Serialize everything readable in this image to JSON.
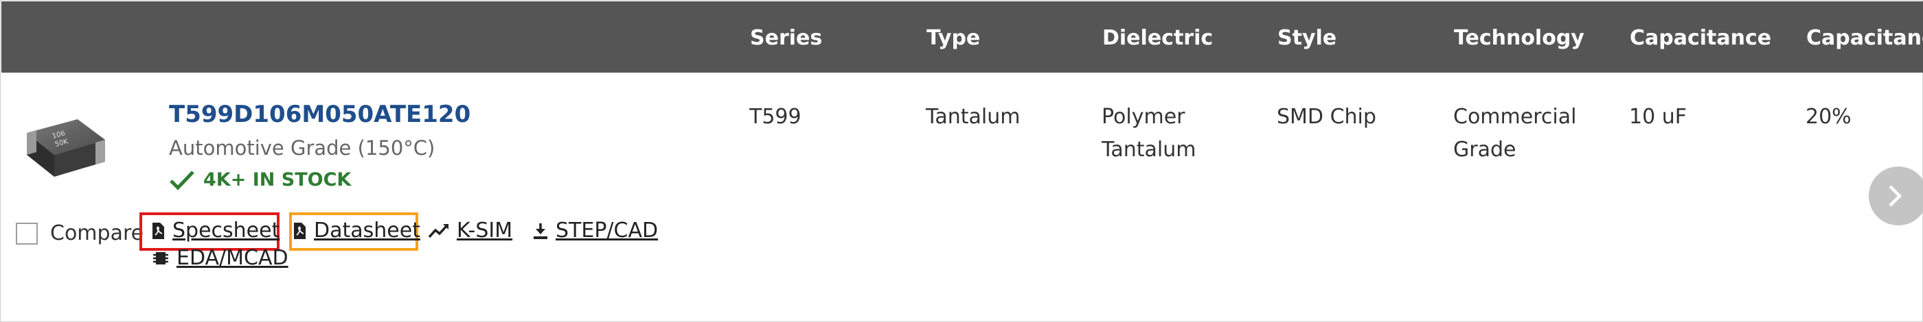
{
  "columns": [
    "Series",
    "Type",
    "Dielectric",
    "Style",
    "Technology",
    "Capacitance",
    "Capacitance"
  ],
  "product": {
    "part_number": "T599D106M050ATE120",
    "grade": "Automotive Grade (150°C)",
    "stock": "4K+ IN STOCK",
    "series": "T599",
    "type": "Tantalum",
    "dielectric_line1": "Polymer",
    "dielectric_line2": "Tantalum",
    "style": "SMD Chip",
    "technology_line1": "Commercial",
    "technology_line2": "Grade",
    "capacitance": "10 uF",
    "tolerance": "20%"
  },
  "actions": {
    "compare": "Compare",
    "specsheet": "Specsheet",
    "datasheet": "Datasheet",
    "ksim": "K-SIM",
    "stepcad": "STEP/CAD",
    "edamcad": "EDA/MCAD"
  },
  "icons": {
    "check": "check-icon",
    "pdf": "pdf-icon",
    "chart": "chart-line-icon",
    "download": "download-icon",
    "chip": "chip-icon",
    "next": "chevron-right-icon"
  },
  "colors": {
    "header_bg": "#555555",
    "part_number": "#1f4e8c",
    "stock": "#2e7d32",
    "highlight_red": "#e01b1b",
    "highlight_orange": "#f5a21b"
  }
}
